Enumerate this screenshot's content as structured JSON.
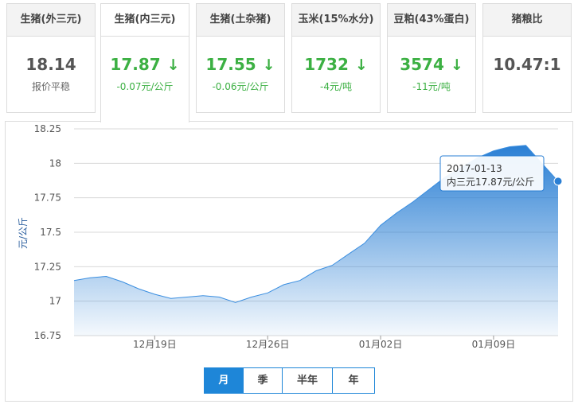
{
  "cards": [
    {
      "title": "生猪(外三元)",
      "value": "18.14",
      "sub": "报价平稳",
      "down": false
    },
    {
      "title": "生猪(内三元)",
      "value": "17.87",
      "sub": "-0.07元/公斤",
      "down": true
    },
    {
      "title": "生猪(土杂猪)",
      "value": "17.55",
      "sub": "-0.06元/公斤",
      "down": true
    },
    {
      "title": "玉米(15%水分)",
      "value": "1732",
      "sub": "-4元/吨",
      "down": true
    },
    {
      "title": "豆粕(43%蛋白)",
      "value": "3574",
      "sub": "-11元/吨",
      "down": true
    },
    {
      "title": "猪粮比",
      "value": "10.47:1",
      "sub": "",
      "down": false
    }
  ],
  "arrow_glyph": "↓",
  "chart_data": {
    "type": "area",
    "ylabel": "元/公斤",
    "ylim": [
      16.75,
      18.25
    ],
    "yticks": [
      "18.25",
      "18",
      "17.75",
      "17.5",
      "17.25",
      "17",
      "16.75"
    ],
    "xticks": [
      {
        "label": "12月19日",
        "index": 5
      },
      {
        "label": "12月26日",
        "index": 12
      },
      {
        "label": "01月02日",
        "index": 19
      },
      {
        "label": "01月09日",
        "index": 26
      }
    ],
    "values": [
      17.15,
      17.17,
      17.18,
      17.14,
      17.09,
      17.05,
      17.02,
      17.03,
      17.04,
      17.03,
      16.99,
      17.03,
      17.06,
      17.12,
      17.15,
      17.22,
      17.26,
      17.34,
      17.42,
      17.55,
      17.64,
      17.72,
      17.81,
      17.9,
      17.97,
      18.04,
      18.09,
      18.12,
      18.13,
      18.0,
      17.87
    ],
    "grid": true,
    "color": "#2a7fd4",
    "tooltip": {
      "date": "2017-01-13",
      "text": "内三元17.87元/公斤"
    }
  },
  "range_buttons": [
    "月",
    "季",
    "半年",
    "年"
  ],
  "selected_range": "月"
}
